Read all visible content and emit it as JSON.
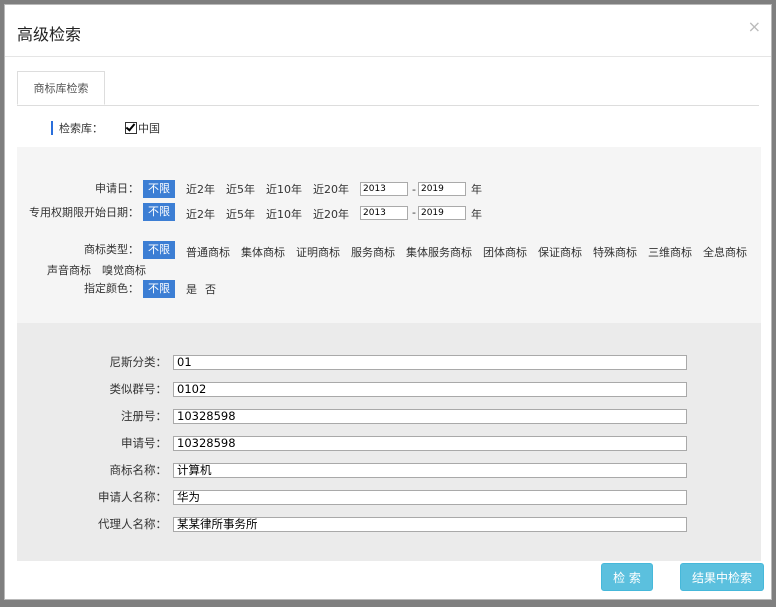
{
  "dialog": {
    "title": "高级检索",
    "close": "×"
  },
  "tab": {
    "label": "商标库检索"
  },
  "library": {
    "label": "检索库：",
    "option": "中国",
    "checked": true
  },
  "filters": {
    "apply_date": {
      "label": "申请日：",
      "nolimit": "不限",
      "options": [
        "近2年",
        "近5年",
        "近10年",
        "近20年"
      ],
      "from": "2013",
      "to": "2019",
      "dash": "-",
      "unit": "年"
    },
    "exclusive_date": {
      "label": "专用权期限开始日期：",
      "nolimit": "不限",
      "options": [
        "近2年",
        "近5年",
        "近10年",
        "近20年"
      ],
      "from": "2013",
      "to": "2019",
      "dash": "-",
      "unit": "年"
    },
    "mark_type": {
      "label": "商标类型：",
      "nolimit": "不限",
      "options": [
        "普通商标",
        "集体商标",
        "证明商标",
        "服务商标",
        "集体服务商标",
        "团体商标",
        "保证商标",
        "特殊商标",
        "三维商标",
        "全息商标",
        "声音商标",
        "嗅觉商标"
      ]
    },
    "color": {
      "label": "指定颜色：",
      "nolimit": "不限",
      "options": [
        "是",
        "否"
      ]
    }
  },
  "fields": [
    {
      "label": "尼斯分类：",
      "value": "01"
    },
    {
      "label": "类似群号：",
      "value": "0102"
    },
    {
      "label": "注册号：",
      "value": "10328598"
    },
    {
      "label": "申请号：",
      "value": "10328598"
    },
    {
      "label": "商标名称：",
      "value": "计算机"
    },
    {
      "label": "申请人名称：",
      "value": "华为"
    },
    {
      "label": "代理人名称：",
      "value": "某某律所事务所"
    }
  ],
  "buttons": {
    "search": "检 索",
    "search_within": "结果中检索"
  },
  "colors": {
    "accent": "#3c7ed4",
    "button": "#5bc0de"
  }
}
